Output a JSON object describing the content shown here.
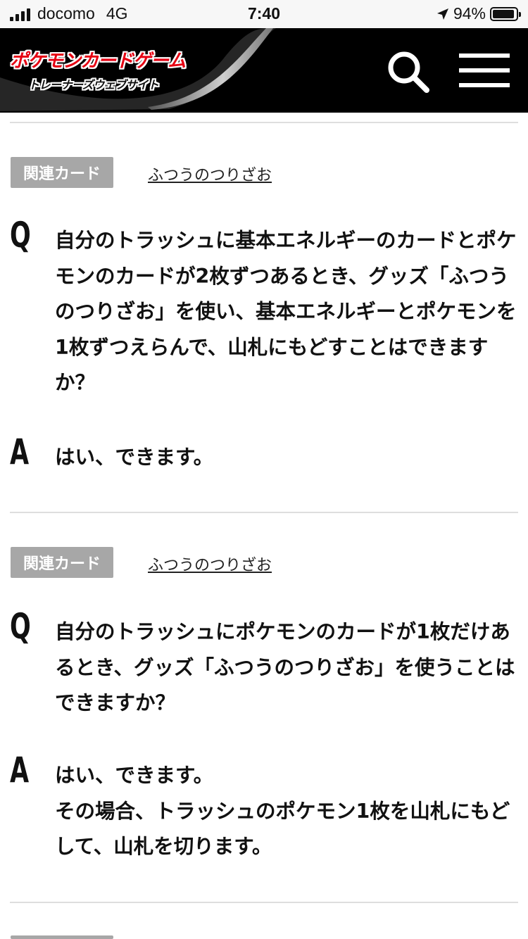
{
  "status_bar": {
    "carrier": "docomo",
    "network": "4G",
    "time": "7:40",
    "battery_percent": "94%",
    "battery_level": 0.94
  },
  "header": {
    "logo_main": "ポケモンカードゲーム",
    "logo_sub": "トレーナーズウェブサイト",
    "colors": {
      "background": "#000000",
      "logo_red": "#e60012"
    }
  },
  "qa_items": [
    {
      "badge_label": "関連カード",
      "related_card": "ふつうのつりざお",
      "q_letter": "Q",
      "question": "自分のトラッシュに基本エネルギーのカードとポケモンのカードが2枚ずつあるとき、グッズ「ふつうのつりざお」を使い、基本エネルギーとポケモンを1枚ずつえらんで、山札にもどすことはできますか？",
      "a_letter": "A",
      "answer_lines": [
        "はい、できます。"
      ]
    },
    {
      "badge_label": "関連カード",
      "related_card": "ふつうのつりざお",
      "q_letter": "Q",
      "question": "自分のトラッシュにポケモンのカードが1枚だけあるとき、グッズ「ふつうのつりざお」を使うことはできますか？",
      "a_letter": "A",
      "answer_lines": [
        "はい、できます。",
        "その場合、トラッシュのポケモン1枚を山札にもどして、山札を切ります。"
      ]
    }
  ]
}
